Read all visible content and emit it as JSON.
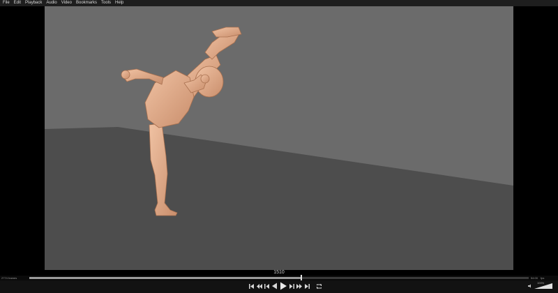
{
  "menu": [
    "File",
    "Edit",
    "Playback",
    "Audio",
    "Video",
    "Bookmarks",
    "Tools",
    "Help"
  ],
  "playback": {
    "current_frame": "1510",
    "frames_count": "2774 frames",
    "timecode": "54:00",
    "speed": "0.0",
    "fps": "fps",
    "progress": 0.544,
    "volume_pct": "100%",
    "volume_level": 1.0
  },
  "icons": [
    "skip-to-start-icon",
    "skip-back-icon",
    "prev-frame-icon",
    "play-reverse-icon",
    "play-icon",
    "next-frame-icon",
    "skip-forward-icon",
    "skip-to-end-icon",
    "loop-icon",
    "volume-icon"
  ],
  "colors": {
    "background": "#000000",
    "menubar": "#1e1e1e",
    "wall": "#6b6b6b",
    "floor": "#4d4d4d",
    "figure": "#e5ad8b"
  }
}
